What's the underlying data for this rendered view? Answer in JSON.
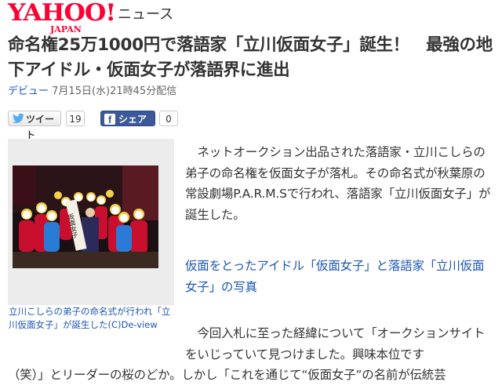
{
  "header": {
    "logo_main": "YAHOO!",
    "logo_sub": "JAPAN",
    "logo_tm": "®",
    "section": "ニュース"
  },
  "article": {
    "title": "命名権25万1000円で落語家「立川仮面女子」誕生！　最強の地下アイドル・仮面女子が落語界に進出",
    "source": "デビュー",
    "date": "7月15日(水)21時45分配信"
  },
  "social": {
    "tweet_label": "ツイート",
    "tweet_count": "19",
    "share_label": "シェア",
    "share_count": "0",
    "tweet_icon": "twitter-bird-icon",
    "share_icon": "facebook-icon",
    "twitter_color": "#55acee",
    "facebook_color": "#3b5998"
  },
  "photo": {
    "sign_text": "仮面女子",
    "caption": "立川こしらの弟子の命名式が行われ「立川仮面女子」が誕生した(C)De-view"
  },
  "body": {
    "paragraph1": "ネットオークション出品された落語家・立川こしらの弟子の命名権を仮面女子が落札。その命名式が秋葉原の常設劇場P.A.R.M.Sで行われ、落語家「立川仮面女子」が誕生した。",
    "photo_link": "仮面をとったアイドル「仮面女子」と落語家「立川仮面女子」の写真",
    "paragraph2_start": "今回入札に至った経緯について「オークションサイトをいじっていて見つけました。興味本位です",
    "paragraph2_cont": "（笑）」とリーダーの桜のどか。しかし「これを通じて“仮面女子”の名前が伝統芸"
  },
  "colors": {
    "yahoo_red": "#ff0033",
    "link_blue": "#1b56b6",
    "text": "#333333"
  }
}
